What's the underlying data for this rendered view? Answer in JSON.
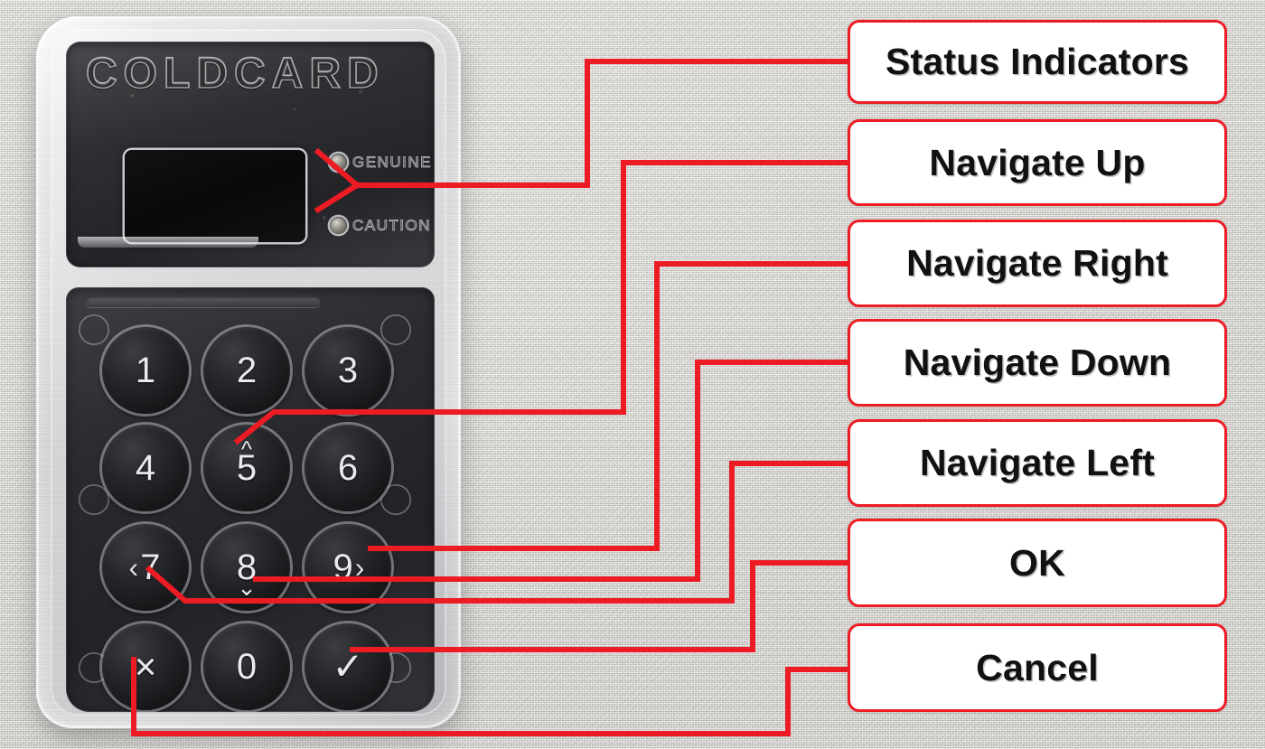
{
  "scene": {
    "kind": "annotated-hardware-photo",
    "subject": "COLDCARD hardware wallet keypad",
    "background_color": "#dbd9d4",
    "annotation_color": "#ed1c24",
    "label_text_color": "#111111",
    "label_fill_color": "#ffffff"
  },
  "device": {
    "brand_emboss": "COLDCARD",
    "screen": {
      "name": "oled-display",
      "state": "off",
      "color": "#0a0b0d"
    },
    "status_leds": [
      {
        "label": "GENUINE",
        "color": "#8e8c84"
      },
      {
        "label": "CAUTION",
        "color": "#8e8c84"
      }
    ],
    "keypad": {
      "rows": [
        [
          {
            "key": "1",
            "digit": "1",
            "pre": "",
            "post": "",
            "up": "",
            "down": ""
          },
          {
            "key": "2",
            "digit": "2",
            "pre": "",
            "post": "",
            "up": "",
            "down": ""
          },
          {
            "key": "3",
            "digit": "3",
            "pre": "",
            "post": "",
            "up": "",
            "down": ""
          }
        ],
        [
          {
            "key": "4",
            "digit": "4",
            "pre": "",
            "post": "",
            "up": "",
            "down": ""
          },
          {
            "key": "5",
            "digit": "5",
            "pre": "",
            "post": "",
            "up": "^",
            "down": ""
          },
          {
            "key": "6",
            "digit": "6",
            "pre": "",
            "post": "",
            "up": "",
            "down": ""
          }
        ],
        [
          {
            "key": "7",
            "digit": "7",
            "pre": "‹",
            "post": "",
            "up": "",
            "down": ""
          },
          {
            "key": "8",
            "digit": "8",
            "pre": "",
            "post": "",
            "up": "",
            "down": "⌄"
          },
          {
            "key": "9",
            "digit": "9",
            "pre": "",
            "post": "›",
            "up": "",
            "down": ""
          }
        ],
        [
          {
            "key": "cancel",
            "digit": "×",
            "pre": "",
            "post": "",
            "up": "",
            "down": ""
          },
          {
            "key": "0",
            "digit": "0",
            "pre": "",
            "post": "",
            "up": "",
            "down": ""
          },
          {
            "key": "ok",
            "digit": "✓",
            "pre": "",
            "post": "",
            "up": "",
            "down": ""
          }
        ]
      ]
    }
  },
  "annotations": [
    {
      "id": "status-indicators",
      "label": "Status Indicators",
      "target": "GENUINE / CAUTION LEDs"
    },
    {
      "id": "navigate-up",
      "label": "Navigate Up",
      "target": "key 5"
    },
    {
      "id": "navigate-right",
      "label": "Navigate Right",
      "target": "key 9"
    },
    {
      "id": "navigate-down",
      "label": "Navigate Down",
      "target": "key 8"
    },
    {
      "id": "navigate-left",
      "label": "Navigate Left",
      "target": "key 7"
    },
    {
      "id": "ok",
      "label": "OK",
      "target": "check key"
    },
    {
      "id": "cancel",
      "label": "Cancel",
      "target": "X key"
    }
  ]
}
